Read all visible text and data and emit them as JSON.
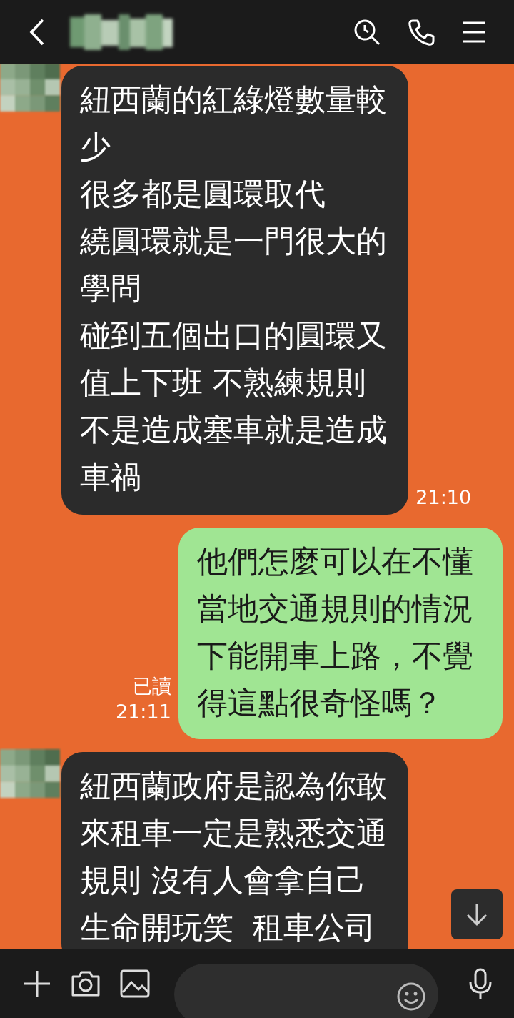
{
  "messages": [
    {
      "kind": "received",
      "lines": [
        "紐西蘭的紅綠燈數量較少",
        "很多都是圓環取代",
        "繞圓環就是一門很大的學問",
        "碰到五個出口的圓環又值上下班 不熟練規則不是造成塞車就是造成車禍"
      ],
      "time": "21:10"
    },
    {
      "kind": "sent",
      "lines": [
        "他們怎麼可以在不懂當地交通規則的情況下能開車上路，不覺得這點很奇怪嗎？"
      ],
      "read": "已讀",
      "time": "21:11"
    },
    {
      "kind": "received",
      "lines": [
        "紐西蘭政府是認為你敢來租車一定是熟悉交通規則 沒有人會拿自己生命開玩笑  租車公司"
      ]
    }
  ]
}
